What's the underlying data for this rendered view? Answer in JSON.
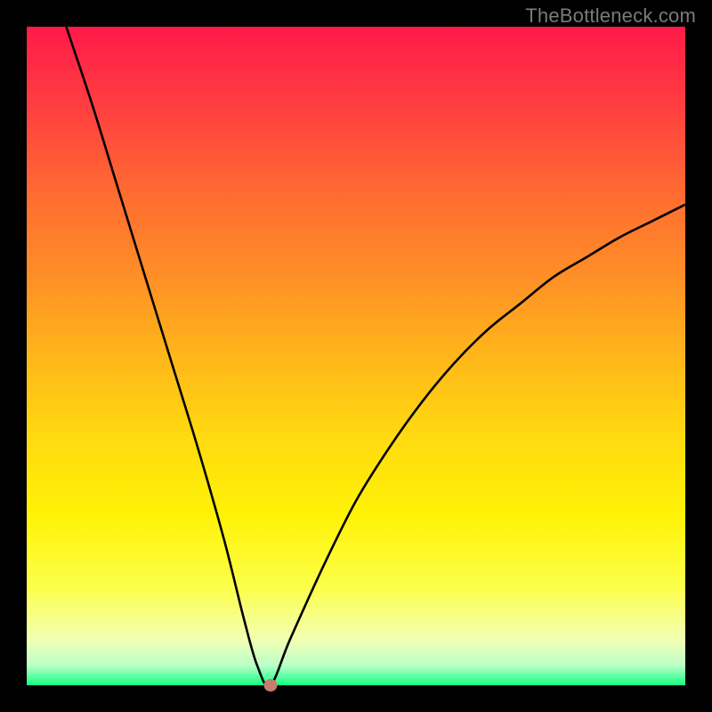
{
  "watermark": "TheBottleneck.com",
  "chart_data": {
    "type": "line",
    "title": "",
    "xlabel": "",
    "ylabel": "",
    "xlim": [
      0,
      100
    ],
    "ylim": [
      0,
      100
    ],
    "background_gradient": {
      "top": "#ff1a49",
      "mid1": "#ff8f26",
      "mid2": "#fff205",
      "bottom": "#11ff82",
      "meaning": "red=high bottleneck, green=low bottleneck"
    },
    "series": [
      {
        "name": "bottleneck-curve",
        "x": [
          6,
          10,
          14,
          18,
          22,
          26,
          30,
          33,
          35,
          37,
          40,
          45,
          50,
          55,
          60,
          65,
          70,
          75,
          80,
          85,
          90,
          95,
          100
        ],
        "y": [
          100,
          88,
          75,
          62,
          49,
          36,
          22,
          10,
          3,
          0,
          7,
          18,
          28,
          36,
          43,
          49,
          54,
          58,
          62,
          65,
          68,
          70.5,
          73
        ]
      }
    ],
    "marker": {
      "x": 37,
      "y": 0,
      "color": "#c67c6f"
    },
    "grid": false,
    "notes": "V-shaped performance/bottleneck curve with minimum near x≈37. Y values are estimated from gradient bands (0=green bottom, 100=red top)."
  },
  "interactive_regions": {
    "marker_label": "optimal-point-marker"
  }
}
